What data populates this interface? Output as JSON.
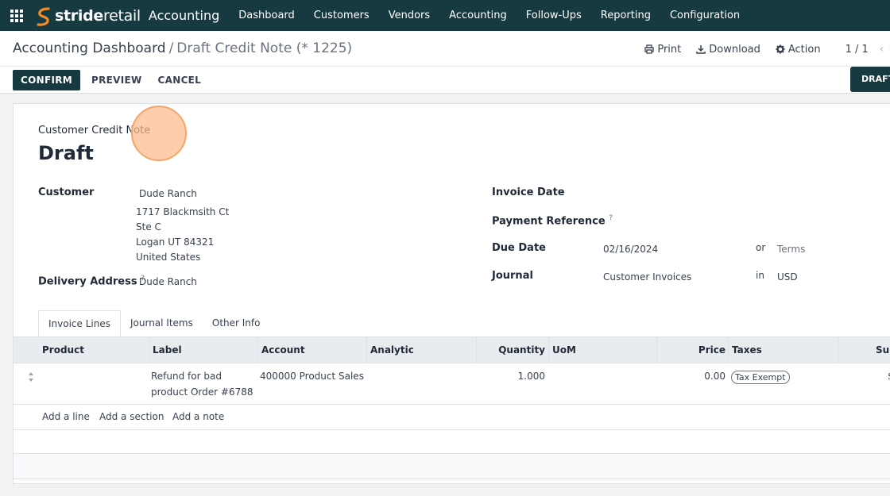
{
  "brand": {
    "name_part1": "stride",
    "name_part2": "retail",
    "app": "Accounting",
    "accent": "#173a41",
    "logo_color": "#f28c28"
  },
  "nav": [
    "Dashboard",
    "Customers",
    "Vendors",
    "Accounting",
    "Follow-Ups",
    "Reporting",
    "Configuration"
  ],
  "breadcrumb": {
    "parent": "Accounting Dashboard",
    "separator": "/",
    "current": "Draft Credit Note (* 1225)"
  },
  "actions": {
    "print": "Print",
    "download": "Download",
    "action": "Action",
    "pager": "1 / 1"
  },
  "buttons": {
    "confirm": "CONFIRM",
    "preview": "PREVIEW",
    "cancel": "CANCEL",
    "status": "DRAFT"
  },
  "form": {
    "doc_type": "Customer Credit Note",
    "title": "Draft",
    "customer_label": "Customer",
    "customer": "Dude Ranch",
    "address": [
      "1717 Blackmsith Ct",
      "Ste C",
      "Logan UT 84321",
      "United States"
    ],
    "delivery_label": "Delivery Address",
    "delivery_help": "?",
    "delivery": "Dude Ranch",
    "invoice_date_label": "Invoice Date",
    "payment_ref_label": "Payment Reference",
    "payment_ref_help": "?",
    "due_date_label": "Due Date",
    "due_date": "02/16/2024",
    "or_text": "or",
    "terms_placeholder": "Terms",
    "journal_label": "Journal",
    "journal": "Customer Invoices",
    "in_text": "in",
    "currency": "USD"
  },
  "tabs": [
    "Invoice Lines",
    "Journal Items",
    "Other Info"
  ],
  "table": {
    "columns": [
      "Product",
      "Label",
      "Account",
      "Analytic",
      "Quantity",
      "UoM",
      "Price",
      "Taxes",
      "Sub"
    ],
    "row": {
      "product": "",
      "label_line1": "Refund for bad",
      "label_line2": "product Order #6788",
      "account": "400000 Product Sales",
      "quantity": "1.000",
      "price": "0.00",
      "tax": "Tax Exempt",
      "subtotal": "$"
    },
    "add_links": [
      "Add a line",
      "Add a section",
      "Add a note"
    ]
  }
}
